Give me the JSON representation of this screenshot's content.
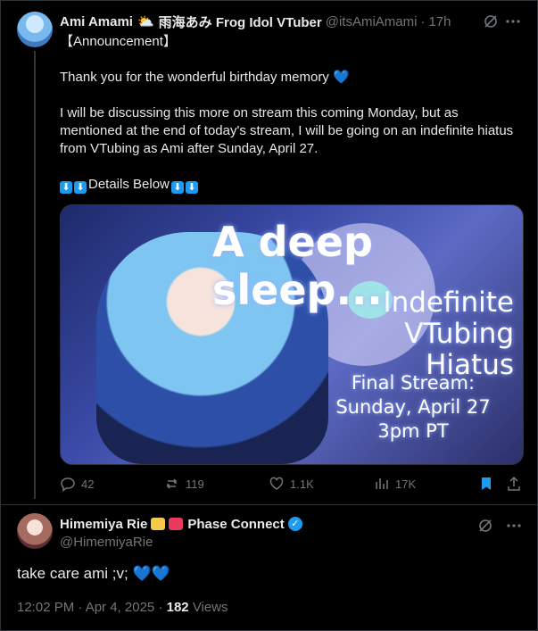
{
  "tweet": {
    "display_name": "Ami Amami",
    "name_suffix": "雨海あみ Frog Idol VTuber",
    "handle": "@itsAmiAmami",
    "separator": "·",
    "time": "17h",
    "line1": "【Announcement】",
    "line2": "Thank you for the wonderful birthday memory",
    "line3": "I will be discussing this more on stream this coming Monday, but as",
    "line4": "mentioned at the end of today's stream, I will be going on an indefinite hiatus",
    "line5": "from VTubing as Ami after Sunday, April 27.",
    "details": "Details Below",
    "image": {
      "title": "A deep sleep...",
      "subtitle_1": "Indefinite",
      "subtitle_2": "VTubing Hiatus",
      "final_1": "Final Stream:",
      "final_2": "Sunday, April 27",
      "final_3": "3pm PT"
    },
    "actions": {
      "replies": "42",
      "reposts": "119",
      "likes": "1.1K",
      "views": "17K"
    }
  },
  "reply": {
    "display_name": "Himemiya Rie",
    "name_suffix": "Phase Connect",
    "handle": "@HimemiyaRie",
    "text": "take care ami ;v;",
    "time": "12:02 PM · Apr 4, 2025 ·",
    "views_count": "182",
    "views_label": "Views"
  },
  "colors": {
    "accent": "#1d9bf0",
    "muted": "#71767b",
    "text": "#e7e9ea",
    "border": "#2f3336"
  }
}
